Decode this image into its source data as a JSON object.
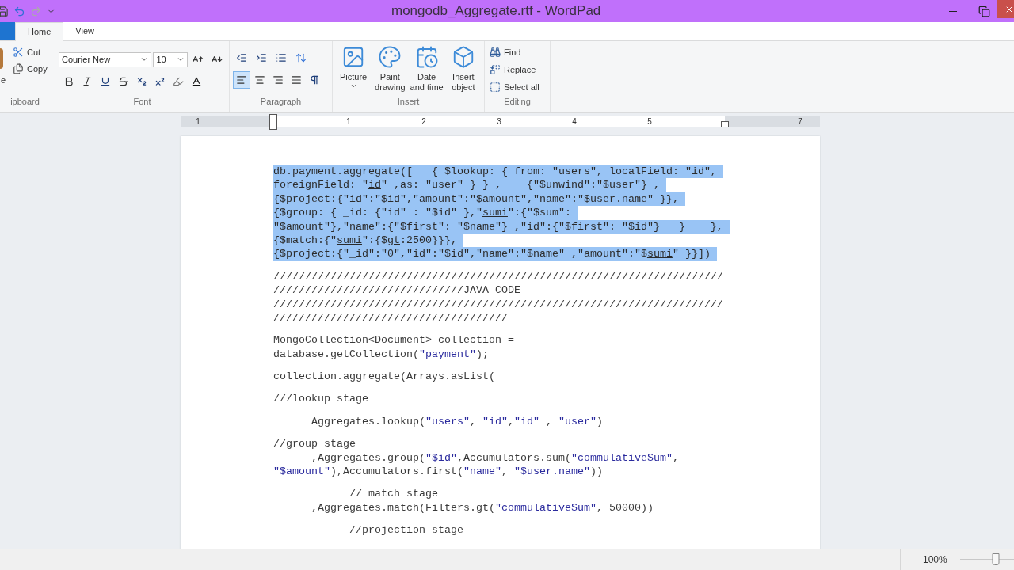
{
  "window": {
    "title": "mongodb_Aggregate.rtf - WordPad"
  },
  "tabs": [
    {
      "label": "Home",
      "selected": true
    },
    {
      "label": "View",
      "selected": false
    }
  ],
  "clipboard": {
    "paste_label": "e",
    "cut": "Cut",
    "copy": "Copy",
    "group_label": "ipboard"
  },
  "font": {
    "family": "Courier New",
    "size": "10",
    "group_label": "Font"
  },
  "paragraph": {
    "alignments": [
      {
        "kind": "left",
        "selected": true
      },
      {
        "kind": "center",
        "selected": false
      },
      {
        "kind": "right",
        "selected": false
      },
      {
        "kind": "justify",
        "selected": false
      }
    ],
    "group_label": "Paragraph"
  },
  "insert": {
    "buttons": [
      {
        "kind": "picture",
        "label": "Picture"
      },
      {
        "kind": "paint",
        "label": "Paint drawing"
      },
      {
        "kind": "datetime",
        "label": "Date and time"
      },
      {
        "kind": "object",
        "label": "Insert object"
      }
    ],
    "group_label": "Insert"
  },
  "editing": {
    "buttons": [
      {
        "kind": "find",
        "label": "Find"
      },
      {
        "kind": "replace",
        "label": "Replace"
      },
      {
        "kind": "select",
        "label": "Select all"
      }
    ],
    "group_label": "Editing"
  },
  "ruler": {
    "labels": [
      "1",
      "1",
      "2",
      "3",
      "4",
      "5",
      "7"
    ]
  },
  "document": {
    "paragraphs": [
      {
        "lines": [
          {
            "selected": true,
            "segments": [
              {
                "kind": "plain",
                "text": "db.payment.aggregate([   { $lookup: { from: \"users\", localField: \"id\","
              }
            ]
          },
          {
            "selected": true,
            "segments": [
              {
                "kind": "plain",
                "text": "foreignField: \""
              },
              {
                "kind": "underline",
                "text": "id"
              },
              {
                "kind": "plain",
                "text": "\" ,as: \"user\" } } ,    {\"$unwind\":\"$user\"} ,"
              }
            ]
          },
          {
            "selected": true,
            "segments": [
              {
                "kind": "plain",
                "text": "{$project:{\"id\":\"$id\",\"amount\":\"$amount\",\"name\":\"$user.name\" }},"
              }
            ]
          },
          {
            "selected": true,
            "segments": [
              {
                "kind": "plain",
                "text": "{$group: { _id: {\"id\" : \"$id\" },\""
              },
              {
                "kind": "underline",
                "text": "sumi"
              },
              {
                "kind": "plain",
                "text": "\":{\"$sum\":"
              }
            ]
          },
          {
            "selected": true,
            "segments": [
              {
                "kind": "plain",
                "text": "\"$amount\"},\"name\":{\"$first\": \"$name\"} ,\"id\":{\"$first\": \"$id\"}   }    },"
              }
            ]
          },
          {
            "selected": true,
            "segments": [
              {
                "kind": "plain",
                "text": "{$match:{\""
              },
              {
                "kind": "underline",
                "text": "sumi"
              },
              {
                "kind": "plain",
                "text": "\":{$"
              },
              {
                "kind": "underline",
                "text": "gt"
              },
              {
                "kind": "plain",
                "text": ":2500}}},"
              }
            ]
          },
          {
            "selected": true,
            "segments": [
              {
                "kind": "plain",
                "text": "{$project:{\"_id\":\"0\",\"id\":\"$id\",\"name\":\"$name\" ,\"amount\":\"$"
              },
              {
                "kind": "underline",
                "text": "sumi"
              },
              {
                "kind": "plain",
                "text": "\" }}])"
              }
            ]
          }
        ]
      },
      {
        "lines": [
          {
            "selected": false,
            "segments": [
              {
                "kind": "plain",
                "text": "///////////////////////////////////////////////////////////////////////"
              }
            ]
          },
          {
            "selected": false,
            "segments": [
              {
                "kind": "plain",
                "text": "//////////////////////////////JAVA CODE"
              }
            ]
          },
          {
            "selected": false,
            "segments": [
              {
                "kind": "plain",
                "text": "///////////////////////////////////////////////////////////////////////"
              }
            ]
          },
          {
            "selected": false,
            "segments": [
              {
                "kind": "plain",
                "text": "/////////////////////////////////////"
              }
            ]
          }
        ]
      },
      {
        "lines": [
          {
            "selected": false,
            "segments": [
              {
                "kind": "plain",
                "text": "MongoCollection<Document> "
              },
              {
                "kind": "underline",
                "text": "collection"
              },
              {
                "kind": "plain",
                "text": " ="
              }
            ]
          },
          {
            "selected": false,
            "segments": [
              {
                "kind": "plain",
                "text": "database.getCollection("
              },
              {
                "kind": "string",
                "text": "\"payment\""
              },
              {
                "kind": "plain",
                "text": ");"
              }
            ]
          }
        ]
      },
      {
        "lines": [
          {
            "selected": false,
            "segments": [
              {
                "kind": "plain",
                "text": "collection.aggregate(Arrays.asList("
              }
            ]
          }
        ]
      },
      {
        "lines": [
          {
            "selected": false,
            "segments": [
              {
                "kind": "plain",
                "text": "///lookup stage"
              }
            ]
          }
        ]
      },
      {
        "lines": [
          {
            "selected": false,
            "segments": [
              {
                "kind": "plain",
                "text": "      Aggregates.lookup("
              },
              {
                "kind": "string",
                "text": "\"users\""
              },
              {
                "kind": "plain",
                "text": ", "
              },
              {
                "kind": "string",
                "text": "\"id\""
              },
              {
                "kind": "plain",
                "text": ","
              },
              {
                "kind": "string",
                "text": "\"id\""
              },
              {
                "kind": "plain",
                "text": " , "
              },
              {
                "kind": "string",
                "text": "\"user\""
              },
              {
                "kind": "plain",
                "text": ")"
              }
            ]
          }
        ]
      },
      {
        "lines": [
          {
            "selected": false,
            "segments": [
              {
                "kind": "plain",
                "text": "//group stage"
              }
            ]
          },
          {
            "selected": false,
            "segments": [
              {
                "kind": "plain",
                "text": "      ,Aggregates.group("
              },
              {
                "kind": "string",
                "text": "\"$id\""
              },
              {
                "kind": "plain",
                "text": ",Accumulators.sum("
              },
              {
                "kind": "string",
                "text": "\"commulativeSum\""
              },
              {
                "kind": "plain",
                "text": ","
              }
            ]
          },
          {
            "selected": false,
            "segments": [
              {
                "kind": "string",
                "text": "\"$amount\""
              },
              {
                "kind": "plain",
                "text": "),Accumulators.first("
              },
              {
                "kind": "string",
                "text": "\"name\""
              },
              {
                "kind": "plain",
                "text": ", "
              },
              {
                "kind": "string",
                "text": "\"$user.name\""
              },
              {
                "kind": "plain",
                "text": "))"
              }
            ]
          }
        ]
      },
      {
        "lines": [
          {
            "selected": false,
            "segments": [
              {
                "kind": "plain",
                "text": "            // match stage"
              }
            ]
          },
          {
            "selected": false,
            "segments": [
              {
                "kind": "plain",
                "text": "      ,Aggregates.match(Filters.gt("
              },
              {
                "kind": "string",
                "text": "\"commulativeSum\""
              },
              {
                "kind": "plain",
                "text": ", 50000))"
              }
            ]
          }
        ]
      },
      {
        "lines": [
          {
            "selected": false,
            "segments": [
              {
                "kind": "plain",
                "text": "            //projection stage"
              }
            ]
          }
        ]
      }
    ]
  },
  "status_bar": {
    "zoom": "100%",
    "zoom_slider": {
      "level": 0.5
    }
  }
}
